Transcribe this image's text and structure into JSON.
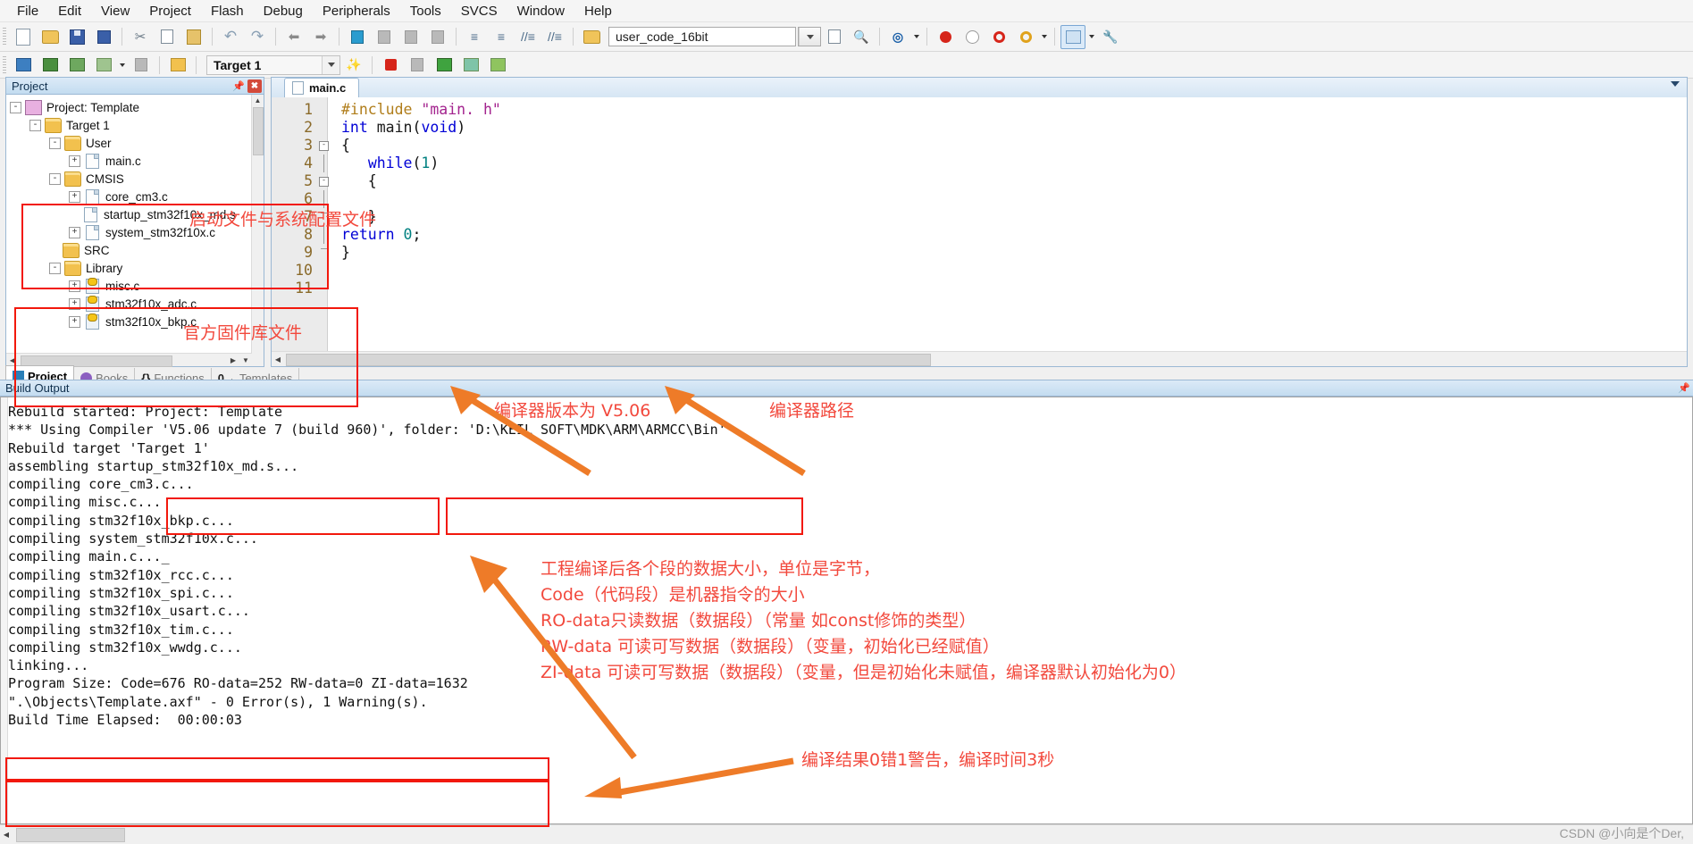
{
  "app": {
    "title": "Keil uVision - Template"
  },
  "menu": {
    "items": [
      "File",
      "Edit",
      "View",
      "Project",
      "Flash",
      "Debug",
      "Peripherals",
      "Tools",
      "SVCS",
      "Window",
      "Help"
    ]
  },
  "toolbar1": {
    "buttons": [
      {
        "name": "new-file",
        "icon": "new-document-icon"
      },
      {
        "name": "open-file",
        "icon": "open-folder-icon"
      },
      {
        "name": "save",
        "icon": "save-disk-icon"
      },
      {
        "name": "save-all",
        "icon": "save-all-icon"
      },
      {
        "name": "cut",
        "icon": "scissors-icon"
      },
      {
        "name": "copy",
        "icon": "copy-icon"
      },
      {
        "name": "paste",
        "icon": "clipboard-icon"
      },
      {
        "name": "undo",
        "icon": "undo-arrow-icon"
      },
      {
        "name": "redo",
        "icon": "redo-arrow-icon"
      },
      {
        "name": "navigate-back",
        "icon": "arrow-left-icon"
      },
      {
        "name": "navigate-forward",
        "icon": "arrow-right-icon"
      },
      {
        "name": "toggle-bookmark",
        "icon": "bookmark-flag-icon"
      },
      {
        "name": "previous-bookmark",
        "icon": "bookmark-prev-icon"
      },
      {
        "name": "next-bookmark",
        "icon": "bookmark-next-icon"
      },
      {
        "name": "clear-bookmarks",
        "icon": "bookmark-clear-icon"
      },
      {
        "name": "indent-right",
        "icon": "indent-right-icon"
      },
      {
        "name": "indent-left",
        "icon": "indent-left-icon"
      },
      {
        "name": "comment-lines",
        "icon": "comment-icon"
      },
      {
        "name": "uncomment-lines",
        "icon": "uncomment-icon"
      },
      {
        "name": "open-project-folder",
        "icon": "folder-search-icon"
      }
    ],
    "combo_value": "user_code_16bit",
    "after_combo": [
      {
        "name": "insert-definition",
        "icon": "definition-icon"
      },
      {
        "name": "find-in-files",
        "icon": "binoculars-icon"
      },
      {
        "name": "debug-query",
        "icon": "magnifier-q-icon"
      },
      {
        "name": "insert-breakpoint",
        "icon": "red-dot-icon"
      },
      {
        "name": "remove-breakpoint",
        "icon": "empty-dot-icon"
      },
      {
        "name": "disable-breakpoint",
        "icon": "ring-red-icon"
      },
      {
        "name": "disable-all-breakpoints",
        "icon": "ring-yellow-icon"
      },
      {
        "name": "manage-windows",
        "icon": "window-layout-icon"
      },
      {
        "name": "configuration",
        "icon": "wrench-icon"
      }
    ]
  },
  "toolbar2": {
    "buttons": [
      {
        "name": "translate-file",
        "icon": "translate-icon"
      },
      {
        "name": "build-target",
        "icon": "build-icon"
      },
      {
        "name": "rebuild-all",
        "icon": "rebuild-icon"
      },
      {
        "name": "batch-build",
        "icon": "batch-build-icon"
      },
      {
        "name": "stop-build",
        "icon": "stop-build-icon"
      },
      {
        "name": "download",
        "icon": "load-icon"
      }
    ],
    "target_value": "Target 1",
    "after_target": [
      {
        "name": "target-options",
        "icon": "target-options-icon"
      },
      {
        "name": "manage-components",
        "icon": "components-icon"
      },
      {
        "name": "pack-installer",
        "icon": "pack-installer-icon"
      },
      {
        "name": "manage-run-time",
        "icon": "runtime-env-icon"
      },
      {
        "name": "select-software-packs",
        "icon": "software-packs-icon"
      },
      {
        "name": "pack-manager",
        "icon": "pack-manager-icon"
      }
    ]
  },
  "project_panel": {
    "title": "Project",
    "pin_icon": "pin-icon",
    "close_icon": "close-icon",
    "tree": [
      {
        "label": "Project: Template",
        "depth": 0,
        "icon": "project-icon",
        "expander": "-"
      },
      {
        "label": "Target 1",
        "depth": 1,
        "icon": "target-folder-icon",
        "expander": "-"
      },
      {
        "label": "User",
        "depth": 2,
        "icon": "folder-icon",
        "expander": "-"
      },
      {
        "label": "main.c",
        "depth": 3,
        "icon": "c-file-icon",
        "expander": "+"
      },
      {
        "label": "CMSIS",
        "depth": 2,
        "icon": "folder-icon",
        "expander": "-"
      },
      {
        "label": "core_cm3.c",
        "depth": 3,
        "icon": "c-file-icon",
        "expander": "+"
      },
      {
        "label": "startup_stm32f10x_md.s",
        "depth": 3,
        "icon": "asm-file-icon",
        "expander": ""
      },
      {
        "label": "system_stm32f10x.c",
        "depth": 3,
        "icon": "c-file-icon",
        "expander": "+"
      },
      {
        "label": "SRC",
        "depth": 2,
        "icon": "folder-icon",
        "expander": ""
      },
      {
        "label": "Library",
        "depth": 2,
        "icon": "folder-icon",
        "expander": "-"
      },
      {
        "label": "misc.c",
        "depth": 3,
        "icon": "c-key-file-icon",
        "expander": "+"
      },
      {
        "label": "stm32f10x_adc.c",
        "depth": 3,
        "icon": "c-key-file-icon",
        "expander": "+"
      },
      {
        "label": "stm32f10x_bkp.c",
        "depth": 3,
        "icon": "c-key-file-icon",
        "expander": "+"
      }
    ],
    "tabs": [
      {
        "label": "Project",
        "icon": "project-tab-icon",
        "active": true
      },
      {
        "label": "Books",
        "icon": "books-tab-icon",
        "active": false
      },
      {
        "label": "Functions",
        "icon": "functions-tab-icon",
        "active": false
      },
      {
        "label": "Templates",
        "icon": "templates-tab-icon",
        "active": false
      }
    ]
  },
  "editor": {
    "tab_label": "main.c",
    "tab_icon": "c-file-icon",
    "chevron_icon": "chevron-down-icon",
    "lines": [
      {
        "n": "1",
        "fold": "none",
        "tokens": [
          {
            "t": "#include ",
            "c": "pre"
          },
          {
            "t": "\"main. h\"",
            "c": "str"
          }
        ]
      },
      {
        "n": "2",
        "fold": "none",
        "tokens": [
          {
            "t": "int ",
            "c": "key"
          },
          {
            "t": "main",
            "c": "fn"
          },
          {
            "t": "(",
            "c": "pl"
          },
          {
            "t": "void",
            "c": "key"
          },
          {
            "t": ")",
            "c": "pl"
          }
        ]
      },
      {
        "n": "3",
        "fold": "box",
        "tokens": [
          {
            "t": "{",
            "c": "pl"
          }
        ]
      },
      {
        "n": "4",
        "fold": "line",
        "tokens": [
          {
            "t": "   ",
            "c": "pl"
          },
          {
            "t": "while",
            "c": "key"
          },
          {
            "t": "(",
            "c": "pl"
          },
          {
            "t": "1",
            "c": "num"
          },
          {
            "t": ")",
            "c": "pl"
          }
        ]
      },
      {
        "n": "5",
        "fold": "box",
        "tokens": [
          {
            "t": "   {",
            "c": "pl"
          }
        ]
      },
      {
        "n": "6",
        "fold": "line",
        "tokens": [
          {
            "t": "",
            "c": "pl"
          }
        ]
      },
      {
        "n": "7",
        "fold": "end",
        "tokens": [
          {
            "t": "   }",
            "c": "pl"
          }
        ]
      },
      {
        "n": "8",
        "fold": "line",
        "tokens": [
          {
            "t": "return ",
            "c": "key"
          },
          {
            "t": "0",
            "c": "num"
          },
          {
            "t": ";",
            "c": "pl"
          }
        ]
      },
      {
        "n": "9",
        "fold": "end",
        "tokens": [
          {
            "t": "}",
            "c": "pl"
          }
        ]
      },
      {
        "n": "10",
        "fold": "none",
        "tokens": [
          {
            "t": "",
            "c": "pl"
          }
        ]
      },
      {
        "n": "11",
        "fold": "none",
        "tokens": [
          {
            "t": "",
            "c": "pl"
          }
        ]
      }
    ]
  },
  "build_output": {
    "title": "Build Output",
    "pin_icon": "pin-icon",
    "lines": [
      {
        "text": "Rebuild started: Project: Template",
        "selected": false
      },
      {
        "text": "*** Using Compiler 'V5.06 update 7 (build 960)', folder: 'D:\\KEIL SOFT\\MDK\\ARM\\ARMCC\\Bin'",
        "selected": false
      },
      {
        "text": "Rebuild target 'Target 1'",
        "selected": false
      },
      {
        "text": "assembling startup_stm32f10x_md.s...",
        "selected": false
      },
      {
        "text": "compiling core_cm3.c...",
        "selected": false
      },
      {
        "text": "compiling misc.c...",
        "selected": false
      },
      {
        "text": "compiling stm32f10x_bkp.c...",
        "selected": false
      },
      {
        "text": "compiling system_stm32f10x.c...",
        "selected": false
      },
      {
        "text": "compiling main.c..._",
        "selected": false
      },
      {
        "text": "compiling stm32f10x_rcc.c...",
        "selected": false
      },
      {
        "text": "compiling stm32f10x_spi.c...",
        "selected": false
      },
      {
        "text": "compiling stm32f10x_usart.c...",
        "selected": false
      },
      {
        "text": "compiling stm32f10x_tim.c...",
        "selected": false
      },
      {
        "text": "compiling stm32f10x_wwdg.c...",
        "selected": false
      },
      {
        "text": "linking...",
        "selected": false
      },
      {
        "text": "Program Size: Code=676 RO-data=252 RW-data=0 ZI-data=1632",
        "selected": false
      },
      {
        "text": "\".\\Objects\\Template.axf\" - 0 Error(s), 1 Warning(s).",
        "selected": false
      },
      {
        "text": "Build Time Elapsed:  00:00:03",
        "selected": true
      }
    ]
  },
  "annotations": {
    "cmsis_note": "启动文件与系统配置文件",
    "library_note": "官方固件库文件",
    "compiler_version_note": "编译器版本为 V5.06",
    "compiler_path_note": "编译器路径",
    "program_size_note": "工程编译后各个段的数据大小，单位是字节，\nCode（代码段）是机器指令的大小\nRO-data只读数据（数据段）（常量 如const修饰的类型）\nRW-data 可读可写数据（数据段）（变量，初始化已经赋值）\nZI-data 可读可写数据（数据段）（变量，但是初始化未赋值，编译器默认初始化为0）",
    "result_note": "编译结果0错1警告，编译时间3秒",
    "colors": {
      "annotation_red": "#f2493d",
      "box_red": "#f2180c",
      "arrow_orange": "#ee7b28"
    }
  },
  "watermark": {
    "text": "CSDN @小向是个Der,"
  }
}
